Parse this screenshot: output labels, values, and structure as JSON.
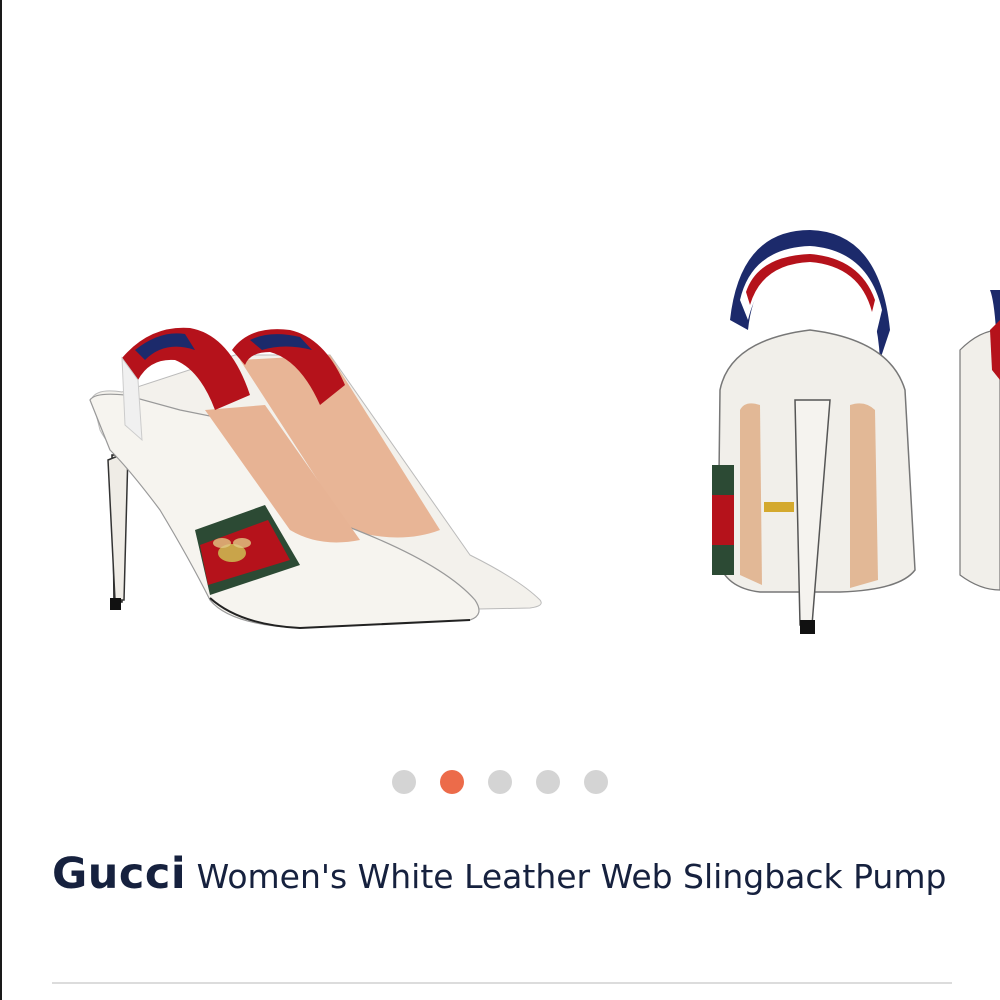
{
  "product": {
    "brand": "Gucci",
    "name": "Women's White Leather Web Slingback Pump"
  },
  "gallery": {
    "image_count": 5,
    "active_index": 1,
    "active_color": "#ec6b4a",
    "inactive_color": "#d4d4d4"
  }
}
